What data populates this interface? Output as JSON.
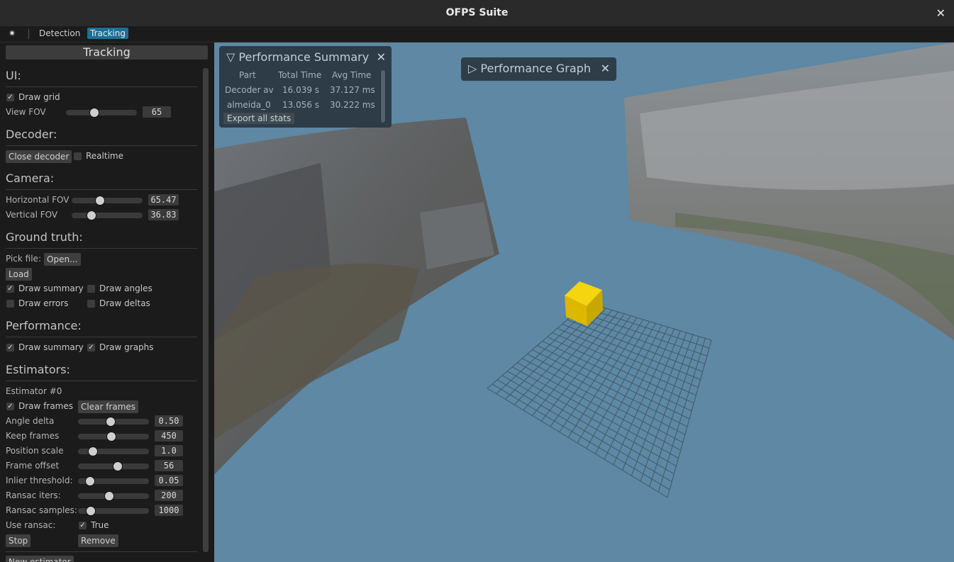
{
  "window": {
    "title": "OFPS Suite",
    "close_glyph": "✕"
  },
  "menu": {
    "icon": "✷",
    "detection": "Detection",
    "tracking": "Tracking"
  },
  "sidebar": {
    "header": "Tracking",
    "ui": {
      "title": "UI:",
      "draw_grid": "Draw grid",
      "view_fov_label": "View FOV",
      "view_fov_value": "65",
      "view_fov_fraction": 0.38
    },
    "decoder": {
      "title": "Decoder:",
      "close_button": "Close decoder",
      "realtime": "Realtime"
    },
    "camera": {
      "title": "Camera:",
      "hfov_label": "Horizontal FOV",
      "hfov_value": "65.47",
      "hfov_fraction": 0.38,
      "vfov_label": "Vertical FOV",
      "vfov_value": "36.83",
      "vfov_fraction": 0.24
    },
    "ground_truth": {
      "title": "Ground truth:",
      "pick_file": "Pick file:",
      "open_button": "Open...",
      "load_button": "Load",
      "draw_summary": "Draw summary",
      "draw_angles": "Draw angles",
      "draw_errors": "Draw errors",
      "draw_deltas": "Draw deltas"
    },
    "performance": {
      "title": "Performance:",
      "draw_summary": "Draw summary",
      "draw_graphs": "Draw graphs"
    },
    "estimators": {
      "title": "Estimators:",
      "estimator_name": "Estimator #0",
      "draw_frames": "Draw frames",
      "clear_frames": "Clear frames",
      "params": [
        {
          "label": "Angle delta",
          "value": "0.50",
          "fraction": 0.44
        },
        {
          "label": "Keep frames",
          "value": "450",
          "fraction": 0.46
        },
        {
          "label": "Position scale",
          "value": "1.0",
          "fraction": 0.16
        },
        {
          "label": "Frame offset",
          "value": "56",
          "fraction": 0.56
        },
        {
          "label": "Inlier threshold:",
          "value": "0.05",
          "fraction": 0.11
        },
        {
          "label": "Ransac iters:",
          "value": "200",
          "fraction": 0.42
        },
        {
          "label": "Ransac samples:",
          "value": "1000",
          "fraction": 0.12
        }
      ],
      "use_ransac_label": "Use ransac:",
      "use_ransac_value": "True",
      "stop_button": "Stop",
      "remove_button": "Remove",
      "new_estimator": "New estimator"
    }
  },
  "perf_summary": {
    "title": "Performance Summary",
    "arrow": "▽",
    "close": "✕",
    "columns": [
      "Part",
      "Total Time",
      "Avg Time"
    ],
    "rows": [
      [
        "Decoder av",
        "16.039 s",
        "37.127 ms"
      ],
      [
        "almeida_0",
        "13.056 s",
        "30.222 ms"
      ]
    ],
    "export": "Export all stats"
  },
  "perf_graph": {
    "title": "Performance Graph",
    "arrow": "▷",
    "close": "✕"
  },
  "colors": {
    "viewport": "#5e88a3",
    "accent": "#1e6e95",
    "cube": "#e2be00"
  }
}
